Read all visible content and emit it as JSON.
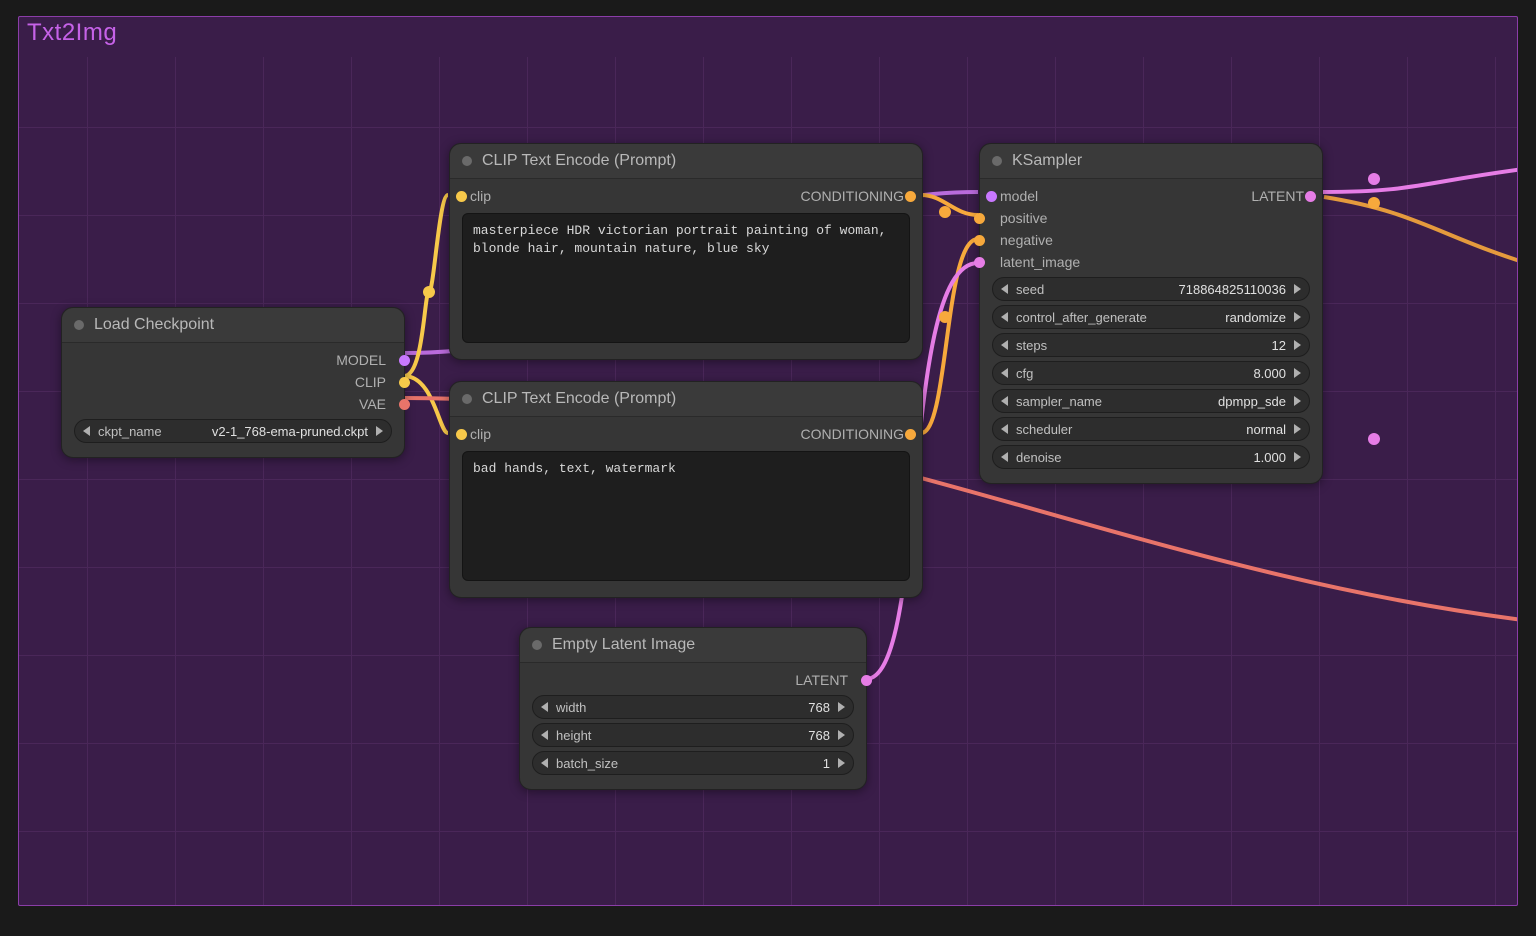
{
  "group": {
    "title": "Txt2Img"
  },
  "nodes": {
    "load_checkpoint": {
      "title": "Load Checkpoint",
      "outputs": {
        "model": "MODEL",
        "clip": "CLIP",
        "vae": "VAE"
      },
      "widgets": {
        "ckpt_name": {
          "label": "ckpt_name",
          "value": "v2-1_768-ema-pruned.ckpt"
        }
      }
    },
    "clip_pos": {
      "title": "CLIP Text Encode (Prompt)",
      "inputs": {
        "clip": "clip"
      },
      "outputs": {
        "cond": "CONDITIONING"
      },
      "text": "masterpiece HDR victorian portrait painting of woman, blonde hair, mountain nature, blue sky"
    },
    "clip_neg": {
      "title": "CLIP Text Encode (Prompt)",
      "inputs": {
        "clip": "clip"
      },
      "outputs": {
        "cond": "CONDITIONING"
      },
      "text": "bad hands, text, watermark"
    },
    "empty_latent": {
      "title": "Empty Latent Image",
      "outputs": {
        "latent": "LATENT"
      },
      "widgets": {
        "width": {
          "label": "width",
          "value": "768"
        },
        "height": {
          "label": "height",
          "value": "768"
        },
        "batch_size": {
          "label": "batch_size",
          "value": "1"
        }
      }
    },
    "ksampler": {
      "title": "KSampler",
      "inputs": {
        "model": "model",
        "positive": "positive",
        "negative": "negative",
        "latent_image": "latent_image"
      },
      "outputs": {
        "latent": "LATENT"
      },
      "widgets": {
        "seed": {
          "label": "seed",
          "value": "718864825110036"
        },
        "control_after_generate": {
          "label": "control_after_generate",
          "value": "randomize"
        },
        "steps": {
          "label": "steps",
          "value": "12"
        },
        "cfg": {
          "label": "cfg",
          "value": "8.000"
        },
        "sampler_name": {
          "label": "sampler_name",
          "value": "dpmpp_sde"
        },
        "scheduler": {
          "label": "scheduler",
          "value": "normal"
        },
        "denoise": {
          "label": "denoise",
          "value": "1.000"
        }
      }
    }
  }
}
